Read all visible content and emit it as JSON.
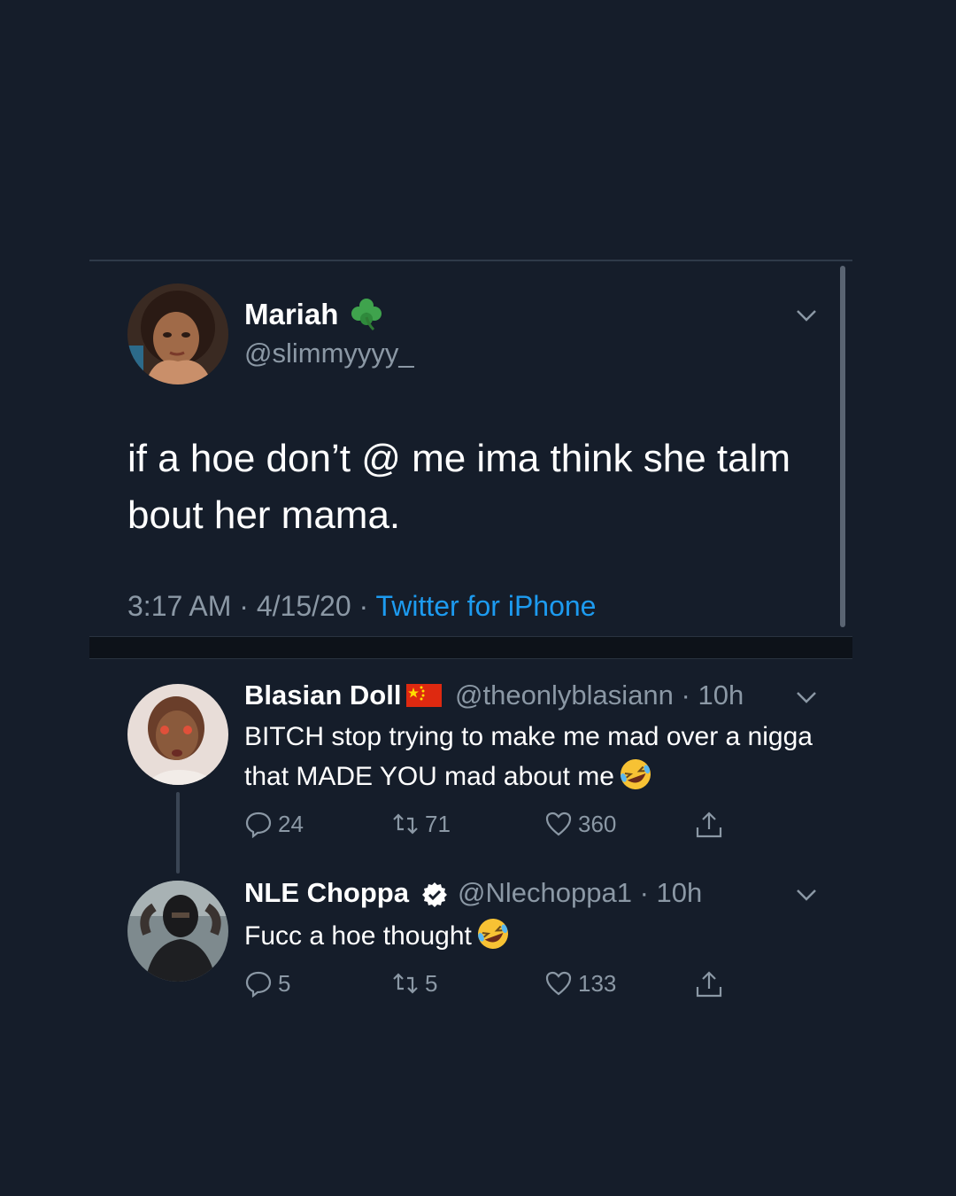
{
  "main_tweet": {
    "name": "Mariah",
    "handle": "@slimmyyyy_",
    "text": "if a hoe don’t @ me ima think she talm bout her mama.",
    "time": "3:17 AM",
    "date": "4/15/20",
    "dot": "·",
    "source": "Twitter for iPhone"
  },
  "replies": [
    {
      "name": "Blasian Doll",
      "handle": "@theonlyblasiann",
      "age": "· 10h",
      "text": "BITCH stop trying to make me mad over a nigga that MADE YOU mad about me",
      "replies": "24",
      "retweets": "71",
      "likes": "360"
    },
    {
      "name": "NLE Choppa",
      "handle": "@Nlechoppa1",
      "age": "· 10h",
      "text": "Fucc a hoe thought",
      "replies": "5",
      "retweets": "5",
      "likes": "133"
    }
  ],
  "colors": {
    "background": "#151d2a",
    "secondary_text": "#8b98a5",
    "link": "#1d9bf0"
  },
  "icons": [
    "clover-icon",
    "chevron-down-icon",
    "reply-icon",
    "retweet-icon",
    "like-icon",
    "share-icon",
    "flag-icon",
    "verified-badge-icon",
    "laughing-emoji"
  ]
}
